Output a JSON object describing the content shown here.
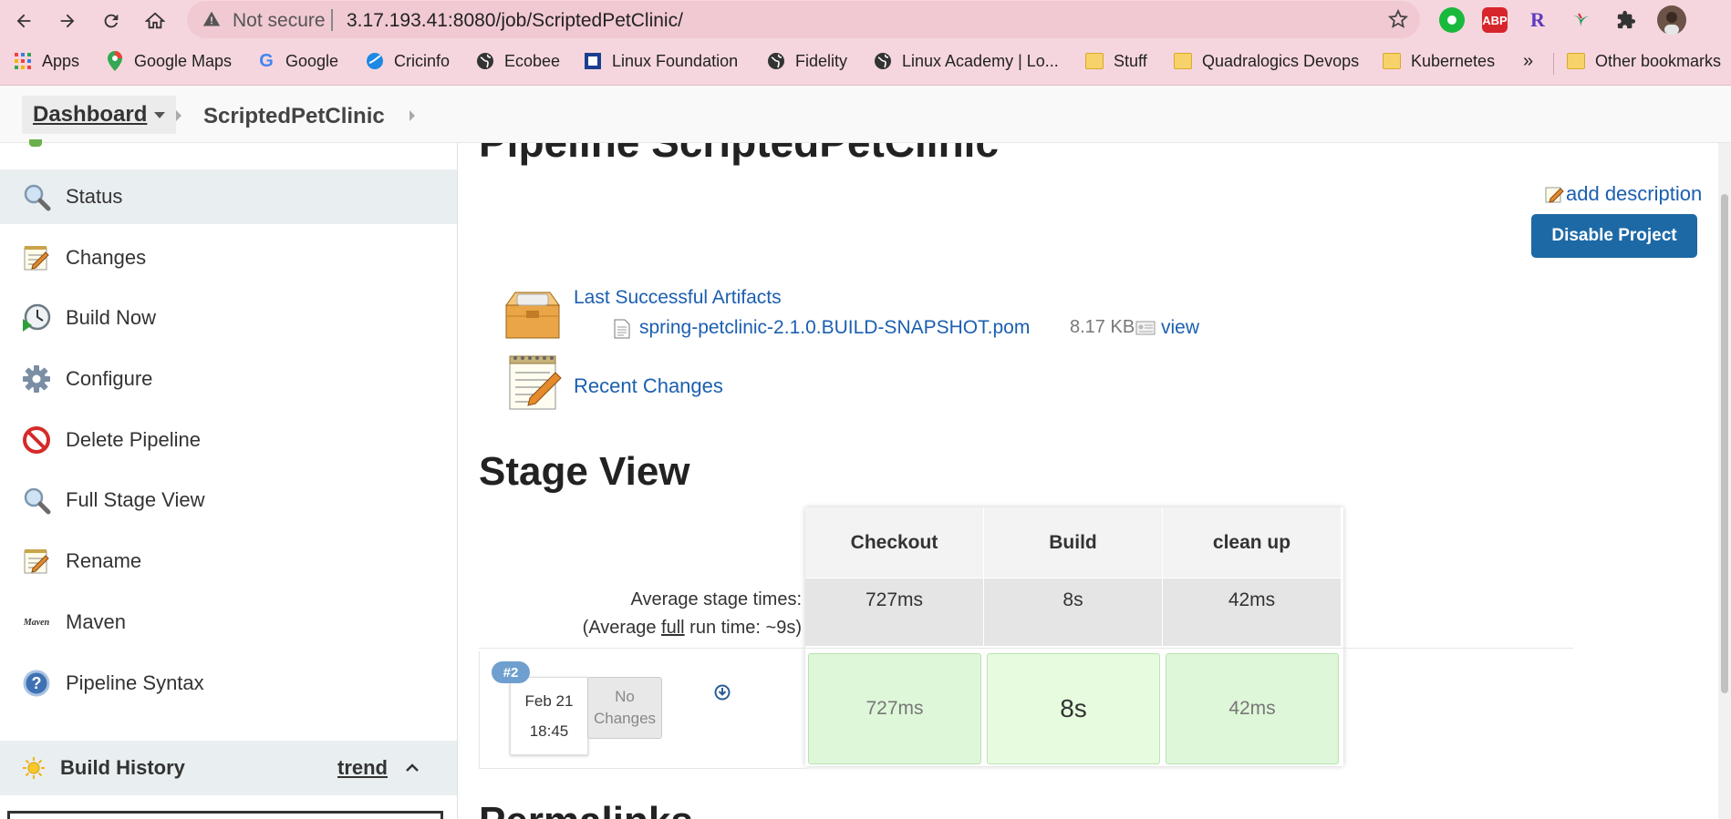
{
  "browser": {
    "security_label": "Not secure",
    "url": "3.17.193.41:8080/job/ScriptedPetClinic/",
    "extensions": {
      "abp_label": "ABP",
      "r_label": "R"
    },
    "bookmarks": [
      {
        "label": "Apps",
        "icon": "apps-grid-icon"
      },
      {
        "label": "Google Maps",
        "icon": "maps-pin-icon"
      },
      {
        "label": "Google",
        "icon": "google-g-icon"
      },
      {
        "label": "Cricinfo",
        "icon": "cricinfo-icon"
      },
      {
        "label": "Ecobee",
        "icon": "globe-icon"
      },
      {
        "label": "Linux Foundation",
        "icon": "linux-foundation-icon"
      },
      {
        "label": "Fidelity",
        "icon": "globe-icon"
      },
      {
        "label": "Linux Academy | Lo...",
        "icon": "globe-icon"
      },
      {
        "label": "Stuff",
        "icon": "folder-icon"
      },
      {
        "label": "Quadralogics Devops",
        "icon": "folder-icon"
      },
      {
        "label": "Kubernetes",
        "icon": "folder-icon"
      }
    ],
    "overflow_label": "»",
    "other_bookmarks": "Other bookmarks"
  },
  "breadcrumb": {
    "dashboard": "Dashboard",
    "job": "ScriptedPetClinic"
  },
  "sidebar": {
    "items": [
      {
        "label": "Status",
        "icon": "search-icon",
        "active": true
      },
      {
        "label": "Changes",
        "icon": "notepad-icon"
      },
      {
        "label": "Build Now",
        "icon": "clock-play-icon"
      },
      {
        "label": "Configure",
        "icon": "gear-icon"
      },
      {
        "label": "Delete Pipeline",
        "icon": "no-entry-icon"
      },
      {
        "label": "Full Stage View",
        "icon": "search-icon"
      },
      {
        "label": "Rename",
        "icon": "notepad-icon"
      },
      {
        "label": "Maven",
        "icon": "maven-icon"
      },
      {
        "label": "Pipeline Syntax",
        "icon": "help-icon"
      }
    ],
    "build_history": {
      "title": "Build History",
      "trend": "trend"
    }
  },
  "main": {
    "title": "Pipeline ScriptedPetClinic",
    "add_description": "add description",
    "disable_button": "Disable Project",
    "artifacts": {
      "heading": "Last Successful Artifacts",
      "file": "spring-petclinic-2.1.0.BUILD-SNAPSHOT.pom",
      "size": "8.17 KB",
      "view": "view"
    },
    "recent_changes": "Recent Changes",
    "stage_view": {
      "heading": "Stage View",
      "avg_label_line1": "Average stage times:",
      "avg_label_line2_prefix": "(Average ",
      "avg_label_line2_link": "full",
      "avg_label_line2_suffix": " run time: ~9s)",
      "stages": [
        {
          "name": "Checkout",
          "avg": "727ms",
          "avg_fraction": 0.04,
          "run": "727ms"
        },
        {
          "name": "Build",
          "avg": "8s",
          "avg_fraction": 1.0,
          "run": "8s"
        },
        {
          "name": "clean up",
          "avg": "42ms",
          "avg_fraction": 0.01,
          "run": "42ms"
        }
      ],
      "build": {
        "number": "#2",
        "date": "Feb 21",
        "time": "18:45",
        "changes_line1": "No",
        "changes_line2": "Changes"
      }
    },
    "permalinks_heading": "Permalinks"
  },
  "colors": {
    "chrome": "#f6d6de",
    "link": "#1b5fb0",
    "primary_button": "#1d69a6",
    "stage_success": "#dff7d9",
    "progress": "#4a8cd6"
  }
}
